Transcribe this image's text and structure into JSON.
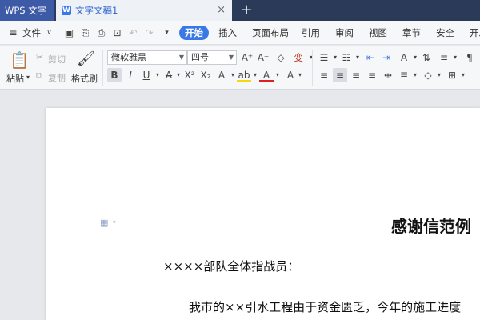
{
  "tabs": {
    "app": "WPS 文字",
    "doc": "文字文稿1",
    "close": "×",
    "add": "+"
  },
  "menu": {
    "file": "文件",
    "items": [
      "开始",
      "插入",
      "页面布局",
      "引用",
      "审阅",
      "视图",
      "章节",
      "安全",
      "开发"
    ]
  },
  "ribbon": {
    "paste": "粘贴",
    "cut": "剪切",
    "copy": "复制",
    "format_painter": "格式刷",
    "font_name": "微软雅黑",
    "font_size": "四号"
  },
  "document": {
    "title": "感谢信范例",
    "salutation": "××××部队全体指战员：",
    "body_line1": "我市的××引水工程由于资金匮乏，今年的施工进度"
  },
  "colors": {
    "accent": "#3b78e7",
    "titlebar": "#2b3a58",
    "app_tab": "#3d5aa6"
  }
}
